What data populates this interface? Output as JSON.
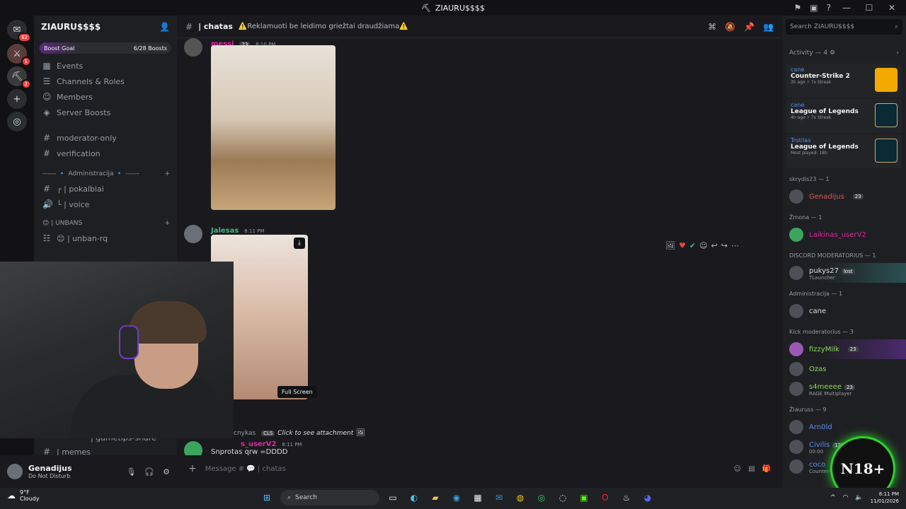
{
  "window": {
    "title": "ZIAURU$$$$"
  },
  "guilds": [
    {
      "badge": "82"
    },
    {
      "badge": "1"
    },
    {
      "badge": "2"
    }
  ],
  "sidebar": {
    "server_name": "ZIAURU$$$$",
    "boost_goal": "Boost Goal",
    "boost_count": "6/28 Boosts",
    "items": [
      {
        "label": "Events"
      },
      {
        "label": "Channels & Roles"
      },
      {
        "label": "Members"
      },
      {
        "label": "Server Boosts"
      }
    ],
    "channels": [
      {
        "label": "moderator-only"
      },
      {
        "label": "verification"
      }
    ],
    "category_admin": "------ 🔹 Administracija 🔹 ------",
    "admin_channels": [
      {
        "label": "┌ | pokalbiai"
      },
      {
        "label": "└ | voice"
      }
    ],
    "category_unbans": "😊 | UNBANS",
    "unban_channel": "😊 | unban-rq",
    "more_channels": [
      {
        "label": "| gametips-share"
      },
      {
        "label": "| memes"
      }
    ]
  },
  "user": {
    "name": "Genadijus",
    "status": "Do Not Disturb"
  },
  "channel": {
    "name": "| chatas",
    "topic": "⚠️Reklamuoti be leidimo griežtai draudžiama⚠️",
    "composer_placeholder": "Message # 💬 | chatas"
  },
  "messages": [
    {
      "author": "messi",
      "tag": "23",
      "time": "8:10 PM"
    },
    {
      "author": "Jalesas",
      "time": "8:11 PM"
    },
    {
      "author": "cnykas",
      "tag": "CLS",
      "text": "Click to see attachment"
    },
    {
      "author": "s_userV2",
      "time": "8:11 PM",
      "text": "Snprotas qrw =DDDD"
    }
  ],
  "tooltip": "Full Screen",
  "right": {
    "search_placeholder": "Search ZIAURU$$$$",
    "activity_header": "Activity — 4",
    "activities": [
      {
        "user": "cane",
        "game": "Counter-Strike 2",
        "sub": "3h ago  ⚡ 7x Streak"
      },
      {
        "user": "cane",
        "game": "League of Legends",
        "sub": "4h ago  ⚡ 7x Streak"
      },
      {
        "user": "Trotilas",
        "game": "League of Legends",
        "sub": "Most played: 18h"
      }
    ],
    "groups": [
      {
        "title": "skrydis23 — 1",
        "members": [
          {
            "name": "Genadijus",
            "tag": "23",
            "color": "#e05757"
          }
        ]
      },
      {
        "title": "Žmona — 1",
        "members": [
          {
            "name": "Laikinas_userV2",
            "color": "#e0279f"
          }
        ]
      },
      {
        "title": "DISCORD MODERATORIUS — 1",
        "members": [
          {
            "name": "pukys27",
            "tag": "lost",
            "sub": "TLauncher",
            "color": "#f2f3f5"
          }
        ]
      },
      {
        "title": "Administracija — 1",
        "members": [
          {
            "name": "cane",
            "color": "#dbdee1"
          }
        ]
      },
      {
        "title": "Kick moderatorius — 3",
        "members": [
          {
            "name": "fizzyMilk",
            "tag": "23",
            "color": "#8ad95a"
          },
          {
            "name": "Ozas",
            "color": "#8ad95a"
          },
          {
            "name": "s4meeee",
            "tag": "23",
            "sub": "RAGE Multiplayer",
            "color": "#8ad95a"
          }
        ]
      },
      {
        "title": "Žiauruss — 9",
        "members": [
          {
            "name": "Arn0ld",
            "color": "#5a8dee"
          },
          {
            "name": "Civilis",
            "tag": "120kg",
            "sub": "00:00",
            "color": "#5a8dee"
          },
          {
            "name": "coco",
            "sub": "Counter-Strike 2",
            "color": "#5a8dee"
          }
        ]
      }
    ]
  },
  "overlay": {
    "badge_text": "N18+"
  },
  "taskbar": {
    "weather_temp": "9°F",
    "weather_cond": "Cloudy",
    "search_label": "Search",
    "time": "8:11 PM",
    "date": "11/01/2026"
  }
}
